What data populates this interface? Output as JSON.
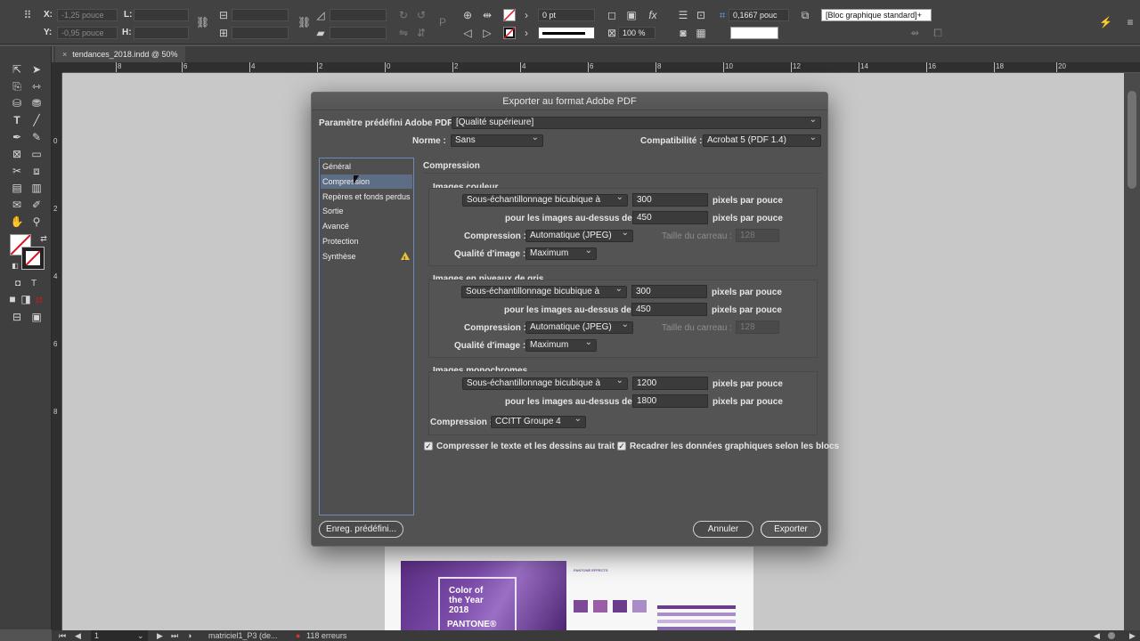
{
  "control_bar": {
    "x_label": "X:",
    "x_value": "-1,25 pouce",
    "y_label": "Y:",
    "y_value": "-0,95 pouce",
    "w_label": "L:",
    "h_label": "H:",
    "stroke_weight": "0 pt",
    "scale_percent": "100 %",
    "ref_value": "0,1667 pouc",
    "object_style": "[Bloc graphique standard]+"
  },
  "document_tab": {
    "close": "×",
    "label": "tendances_2018.indd @ 50%"
  },
  "ruler_h": [
    "8",
    "6",
    "4",
    "2",
    "0",
    "2",
    "4",
    "6",
    "8",
    "10",
    "12",
    "14",
    "16",
    "18",
    "20"
  ],
  "ruler_v": [
    "0",
    "2",
    "4",
    "6",
    "8"
  ],
  "page_preview": {
    "title": "Color of\nthe Year\n2018",
    "logo": "PANTONE®",
    "swatch_heading": "PANTONE EFFECTS",
    "colors": [
      "#7d4a97",
      "#9b5ea6",
      "#6b3c8c",
      "#a98cc8",
      "#c9b4de",
      "#8a6bb0"
    ]
  },
  "status_bar": {
    "page": "1",
    "master": "matriciel1_P3 (de...",
    "errors": "118 erreurs"
  },
  "dialog": {
    "title": "Exporter au format Adobe PDF",
    "preset_label": "Paramètre prédéfini Adobe PDF :",
    "preset_value": "[Qualité supérieure]",
    "norme_label": "Norme :",
    "norme_value": "Sans",
    "compat_label": "Compatibilité :",
    "compat_value": "Acrobat 5 (PDF 1.4)",
    "sidebar": [
      {
        "label": "Général",
        "active": false
      },
      {
        "label": "Compression",
        "active": true
      },
      {
        "label": "Repères et fonds perdus",
        "active": false
      },
      {
        "label": "Sortie",
        "active": false
      },
      {
        "label": "Avancé",
        "active": false
      },
      {
        "label": "Protection",
        "active": false
      },
      {
        "label": "Synthèse",
        "active": false,
        "warning": true
      }
    ],
    "section_title": "Compression",
    "color": {
      "heading": "Images couleur",
      "method": "Sous-échantillonnage bicubique à",
      "ppi": "300",
      "ppi_unit": "pixels par pouce",
      "above_label": "pour les images au-dessus de :",
      "above": "450",
      "above_unit": "pixels par pouce",
      "compression_label": "Compression :",
      "compression": "Automatique (JPEG)",
      "tile_label": "Taille du carreau :",
      "tile": "128",
      "quality_label": "Qualité d'image :",
      "quality": "Maximum"
    },
    "gray": {
      "heading": "Images en niveaux de gris",
      "method": "Sous-échantillonnage bicubique à",
      "ppi": "300",
      "ppi_unit": "pixels par pouce",
      "above_label": "pour les images au-dessus de :",
      "above": "450",
      "above_unit": "pixels par pouce",
      "compression_label": "Compression :",
      "compression": "Automatique (JPEG)",
      "tile_label": "Taille du carreau :",
      "tile": "128",
      "quality_label": "Qualité d'image :",
      "quality": "Maximum"
    },
    "mono": {
      "heading": "Images monochromes",
      "method": "Sous-échantillonnage bicubique à",
      "ppi": "1200",
      "ppi_unit": "pixels par pouce",
      "above_label": "pour les images au-dessus de :",
      "above": "1800",
      "above_unit": "pixels par pouce",
      "compression_label": "Compression :",
      "compression": "CCITT Groupe 4"
    },
    "compress_text_label": "Compresser le texte et les dessins au trait",
    "crop_label": "Recadrer les données graphiques selon les blocs",
    "save_preset": "Enreg. prédéfini...",
    "cancel": "Annuler",
    "export": "Exporter"
  }
}
